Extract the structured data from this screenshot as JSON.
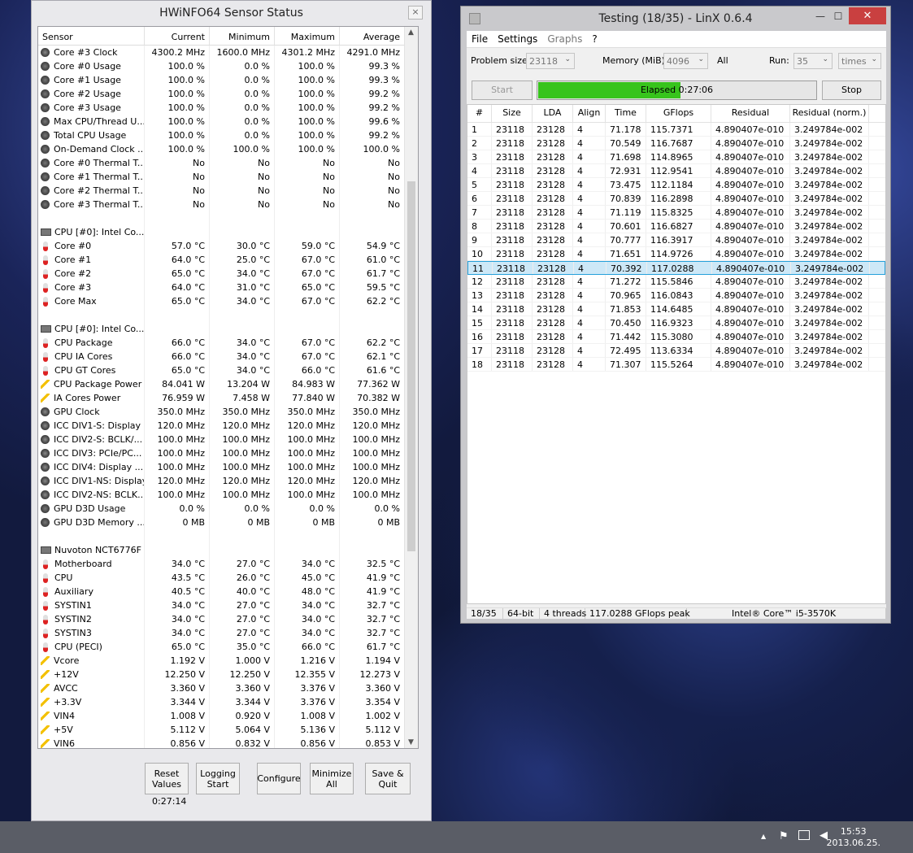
{
  "hwinfo": {
    "title": "HWiNFO64 Sensor Status",
    "close": "×",
    "columns": [
      "Sensor",
      "Current",
      "Minimum",
      "Maximum",
      "Average"
    ],
    "rows": [
      {
        "icon": "clock",
        "name": "Core #3 Clock",
        "cur": "4300.2 MHz",
        "min": "1600.0 MHz",
        "max": "4301.2 MHz",
        "avg": "4291.0 MHz"
      },
      {
        "icon": "usage",
        "name": "Core #0 Usage",
        "cur": "100.0 %",
        "min": "0.0 %",
        "max": "100.0 %",
        "avg": "99.3 %"
      },
      {
        "icon": "usage",
        "name": "Core #1 Usage",
        "cur": "100.0 %",
        "min": "0.0 %",
        "max": "100.0 %",
        "avg": "99.3 %"
      },
      {
        "icon": "usage",
        "name": "Core #2 Usage",
        "cur": "100.0 %",
        "min": "0.0 %",
        "max": "100.0 %",
        "avg": "99.2 %"
      },
      {
        "icon": "usage",
        "name": "Core #3 Usage",
        "cur": "100.0 %",
        "min": "0.0 %",
        "max": "100.0 %",
        "avg": "99.2 %"
      },
      {
        "icon": "usage",
        "name": "Max CPU/Thread U...",
        "cur": "100.0 %",
        "min": "0.0 %",
        "max": "100.0 %",
        "avg": "99.6 %"
      },
      {
        "icon": "usage",
        "name": "Total CPU Usage",
        "cur": "100.0 %",
        "min": "0.0 %",
        "max": "100.0 %",
        "avg": "99.2 %"
      },
      {
        "icon": "usage",
        "name": "On-Demand Clock ...",
        "cur": "100.0 %",
        "min": "100.0 %",
        "max": "100.0 %",
        "avg": "100.0 %"
      },
      {
        "icon": "usage",
        "name": "Core #0 Thermal T...",
        "cur": "No",
        "min": "No",
        "max": "No",
        "avg": "No"
      },
      {
        "icon": "usage",
        "name": "Core #1 Thermal T...",
        "cur": "No",
        "min": "No",
        "max": "No",
        "avg": "No"
      },
      {
        "icon": "usage",
        "name": "Core #2 Thermal T...",
        "cur": "No",
        "min": "No",
        "max": "No",
        "avg": "No"
      },
      {
        "icon": "usage",
        "name": "Core #3 Thermal T...",
        "cur": "No",
        "min": "No",
        "max": "No",
        "avg": "No"
      },
      {
        "icon": "",
        "name": "",
        "cur": "",
        "min": "",
        "max": "",
        "avg": ""
      },
      {
        "icon": "chip",
        "name": "CPU [#0]: Intel Co...",
        "cur": "",
        "min": "",
        "max": "",
        "avg": ""
      },
      {
        "icon": "temp",
        "name": "Core #0",
        "cur": "57.0 °C",
        "min": "30.0 °C",
        "max": "59.0 °C",
        "avg": "54.9 °C"
      },
      {
        "icon": "temp",
        "name": "Core #1",
        "cur": "64.0 °C",
        "min": "25.0 °C",
        "max": "67.0 °C",
        "avg": "61.0 °C"
      },
      {
        "icon": "temp",
        "name": "Core #2",
        "cur": "65.0 °C",
        "min": "34.0 °C",
        "max": "67.0 °C",
        "avg": "61.7 °C"
      },
      {
        "icon": "temp",
        "name": "Core #3",
        "cur": "64.0 °C",
        "min": "31.0 °C",
        "max": "65.0 °C",
        "avg": "59.5 °C"
      },
      {
        "icon": "temp",
        "name": "Core Max",
        "cur": "65.0 °C",
        "min": "34.0 °C",
        "max": "67.0 °C",
        "avg": "62.2 °C"
      },
      {
        "icon": "",
        "name": "",
        "cur": "",
        "min": "",
        "max": "",
        "avg": ""
      },
      {
        "icon": "chip",
        "name": "CPU [#0]: Intel Co...",
        "cur": "",
        "min": "",
        "max": "",
        "avg": ""
      },
      {
        "icon": "temp",
        "name": "CPU Package",
        "cur": "66.0 °C",
        "min": "34.0 °C",
        "max": "67.0 °C",
        "avg": "62.2 °C"
      },
      {
        "icon": "temp",
        "name": "CPU IA Cores",
        "cur": "66.0 °C",
        "min": "34.0 °C",
        "max": "67.0 °C",
        "avg": "62.1 °C"
      },
      {
        "icon": "temp",
        "name": "CPU GT Cores",
        "cur": "65.0 °C",
        "min": "34.0 °C",
        "max": "66.0 °C",
        "avg": "61.6 °C"
      },
      {
        "icon": "power",
        "name": "CPU Package Power",
        "cur": "84.041 W",
        "min": "13.204 W",
        "max": "84.983 W",
        "avg": "77.362 W"
      },
      {
        "icon": "power",
        "name": "IA Cores Power",
        "cur": "76.959 W",
        "min": "7.458 W",
        "max": "77.840 W",
        "avg": "70.382 W"
      },
      {
        "icon": "clock",
        "name": "GPU Clock",
        "cur": "350.0 MHz",
        "min": "350.0 MHz",
        "max": "350.0 MHz",
        "avg": "350.0 MHz"
      },
      {
        "icon": "clock",
        "name": "ICC DIV1-S: Display",
        "cur": "120.0 MHz",
        "min": "120.0 MHz",
        "max": "120.0 MHz",
        "avg": "120.0 MHz"
      },
      {
        "icon": "clock",
        "name": "ICC DIV2-S: BCLK/...",
        "cur": "100.0 MHz",
        "min": "100.0 MHz",
        "max": "100.0 MHz",
        "avg": "100.0 MHz"
      },
      {
        "icon": "clock",
        "name": "ICC DIV3: PCIe/PC...",
        "cur": "100.0 MHz",
        "min": "100.0 MHz",
        "max": "100.0 MHz",
        "avg": "100.0 MHz"
      },
      {
        "icon": "clock",
        "name": "ICC DIV4: Display ...",
        "cur": "100.0 MHz",
        "min": "100.0 MHz",
        "max": "100.0 MHz",
        "avg": "100.0 MHz"
      },
      {
        "icon": "clock",
        "name": "ICC DIV1-NS: Display",
        "cur": "120.0 MHz",
        "min": "120.0 MHz",
        "max": "120.0 MHz",
        "avg": "120.0 MHz"
      },
      {
        "icon": "clock",
        "name": "ICC DIV2-NS: BCLK...",
        "cur": "100.0 MHz",
        "min": "100.0 MHz",
        "max": "100.0 MHz",
        "avg": "100.0 MHz"
      },
      {
        "icon": "usage",
        "name": "GPU D3D Usage",
        "cur": "0.0 %",
        "min": "0.0 %",
        "max": "0.0 %",
        "avg": "0.0 %"
      },
      {
        "icon": "usage",
        "name": "GPU D3D Memory ...",
        "cur": "0 MB",
        "min": "0 MB",
        "max": "0 MB",
        "avg": "0 MB"
      },
      {
        "icon": "",
        "name": "",
        "cur": "",
        "min": "",
        "max": "",
        "avg": ""
      },
      {
        "icon": "chip",
        "name": "Nuvoton NCT6776F",
        "cur": "",
        "min": "",
        "max": "",
        "avg": ""
      },
      {
        "icon": "temp",
        "name": "Motherboard",
        "cur": "34.0 °C",
        "min": "27.0 °C",
        "max": "34.0 °C",
        "avg": "32.5 °C"
      },
      {
        "icon": "temp",
        "name": "CPU",
        "cur": "43.5 °C",
        "min": "26.0 °C",
        "max": "45.0 °C",
        "avg": "41.9 °C"
      },
      {
        "icon": "temp",
        "name": "Auxiliary",
        "cur": "40.5 °C",
        "min": "40.0 °C",
        "max": "48.0 °C",
        "avg": "41.9 °C"
      },
      {
        "icon": "temp",
        "name": "SYSTIN1",
        "cur": "34.0 °C",
        "min": "27.0 °C",
        "max": "34.0 °C",
        "avg": "32.7 °C"
      },
      {
        "icon": "temp",
        "name": "SYSTIN2",
        "cur": "34.0 °C",
        "min": "27.0 °C",
        "max": "34.0 °C",
        "avg": "32.7 °C"
      },
      {
        "icon": "temp",
        "name": "SYSTIN3",
        "cur": "34.0 °C",
        "min": "27.0 °C",
        "max": "34.0 °C",
        "avg": "32.7 °C"
      },
      {
        "icon": "temp",
        "name": "CPU (PECI)",
        "cur": "65.0 °C",
        "min": "35.0 °C",
        "max": "66.0 °C",
        "avg": "61.7 °C"
      },
      {
        "icon": "power",
        "name": "Vcore",
        "cur": "1.192 V",
        "min": "1.000 V",
        "max": "1.216 V",
        "avg": "1.194 V"
      },
      {
        "icon": "power",
        "name": "+12V",
        "cur": "12.250 V",
        "min": "12.250 V",
        "max": "12.355 V",
        "avg": "12.273 V"
      },
      {
        "icon": "power",
        "name": "AVCC",
        "cur": "3.360 V",
        "min": "3.360 V",
        "max": "3.376 V",
        "avg": "3.360 V"
      },
      {
        "icon": "power",
        "name": "+3.3V",
        "cur": "3.344 V",
        "min": "3.344 V",
        "max": "3.376 V",
        "avg": "3.354 V"
      },
      {
        "icon": "power",
        "name": "VIN4",
        "cur": "1.008 V",
        "min": "0.920 V",
        "max": "1.008 V",
        "avg": "1.002 V"
      },
      {
        "icon": "power",
        "name": "+5V",
        "cur": "5.112 V",
        "min": "5.064 V",
        "max": "5.136 V",
        "avg": "5.112 V"
      },
      {
        "icon": "power",
        "name": "VIN6",
        "cur": "0.856 V",
        "min": "0.832 V",
        "max": "0.856 V",
        "avg": "0.853 V"
      }
    ],
    "buttons": {
      "reset": "Reset Values",
      "logging": "Logging Start",
      "configure": "Configure",
      "minimize": "Minimize All",
      "save": "Save & Quit"
    },
    "timer": "0:27:14"
  },
  "linx": {
    "title": "Testing (18/35) - LinX 0.6.4",
    "window_buttons": {
      "minimize": "—",
      "maximize": "☐",
      "close": "✕"
    },
    "menu": [
      "File",
      "Settings",
      "Graphs",
      "?"
    ],
    "problem_size_label": "Problem size:",
    "problem_size_value": "23118",
    "memory_label": "Memory (MiB):",
    "memory_value": "4096",
    "all_label": "All",
    "run_label": "Run:",
    "run_value": "35",
    "run_unit": "times",
    "start_button": "Start",
    "stop_button": "Stop",
    "progress_text": "Elapsed 0:27:06",
    "progress_fraction": 0.51,
    "columns": [
      "#",
      "Size",
      "LDA",
      "Align",
      "Time",
      "GFlops",
      "Residual",
      "Residual (norm.)"
    ],
    "rows": [
      [
        "1",
        "23118",
        "23128",
        "4",
        "71.178",
        "115.7371",
        "4.890407e-010",
        "3.249784e-002"
      ],
      [
        "2",
        "23118",
        "23128",
        "4",
        "70.549",
        "116.7687",
        "4.890407e-010",
        "3.249784e-002"
      ],
      [
        "3",
        "23118",
        "23128",
        "4",
        "71.698",
        "114.8965",
        "4.890407e-010",
        "3.249784e-002"
      ],
      [
        "4",
        "23118",
        "23128",
        "4",
        "72.931",
        "112.9541",
        "4.890407e-010",
        "3.249784e-002"
      ],
      [
        "5",
        "23118",
        "23128",
        "4",
        "73.475",
        "112.1184",
        "4.890407e-010",
        "3.249784e-002"
      ],
      [
        "6",
        "23118",
        "23128",
        "4",
        "70.839",
        "116.2898",
        "4.890407e-010",
        "3.249784e-002"
      ],
      [
        "7",
        "23118",
        "23128",
        "4",
        "71.119",
        "115.8325",
        "4.890407e-010",
        "3.249784e-002"
      ],
      [
        "8",
        "23118",
        "23128",
        "4",
        "70.601",
        "116.6827",
        "4.890407e-010",
        "3.249784e-002"
      ],
      [
        "9",
        "23118",
        "23128",
        "4",
        "70.777",
        "116.3917",
        "4.890407e-010",
        "3.249784e-002"
      ],
      [
        "10",
        "23118",
        "23128",
        "4",
        "71.651",
        "114.9726",
        "4.890407e-010",
        "3.249784e-002"
      ],
      [
        "11",
        "23118",
        "23128",
        "4",
        "70.392",
        "117.0288",
        "4.890407e-010",
        "3.249784e-002"
      ],
      [
        "12",
        "23118",
        "23128",
        "4",
        "71.272",
        "115.5846",
        "4.890407e-010",
        "3.249784e-002"
      ],
      [
        "13",
        "23118",
        "23128",
        "4",
        "70.965",
        "116.0843",
        "4.890407e-010",
        "3.249784e-002"
      ],
      [
        "14",
        "23118",
        "23128",
        "4",
        "71.853",
        "114.6485",
        "4.890407e-010",
        "3.249784e-002"
      ],
      [
        "15",
        "23118",
        "23128",
        "4",
        "70.450",
        "116.9323",
        "4.890407e-010",
        "3.249784e-002"
      ],
      [
        "16",
        "23118",
        "23128",
        "4",
        "71.442",
        "115.3080",
        "4.890407e-010",
        "3.249784e-002"
      ],
      [
        "17",
        "23118",
        "23128",
        "4",
        "72.495",
        "113.6334",
        "4.890407e-010",
        "3.249784e-002"
      ],
      [
        "18",
        "23118",
        "23128",
        "4",
        "71.307",
        "115.5264",
        "4.890407e-010",
        "3.249784e-002"
      ]
    ],
    "selected_row": 10,
    "status": [
      "18/35",
      "64-bit",
      "4 threads",
      "117.0288 GFlops peak",
      "Intel® Core™ i5-3570K"
    ]
  },
  "taskbar": {
    "tray_arrow": "▲",
    "time": "15:53",
    "date": "2013.06.25."
  }
}
